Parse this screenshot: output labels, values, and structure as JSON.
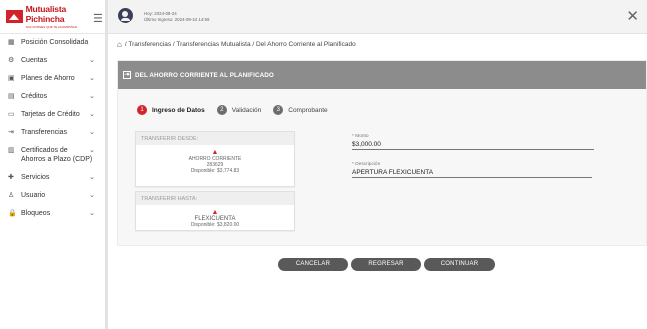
{
  "brand": {
    "name": "Mutualista Pichincha",
    "sub": "SOLUCIONES QUE TE ACOMPAÑAN"
  },
  "topbar": {
    "today": "Hoy: 2024-09-24",
    "last_login": "Último Ingreso: 2024-09-24 14:59"
  },
  "breadcrumb": {
    "path": "/ Transferencias / Transferencias Mutualista / Del Ahorro Corriente al Planificado"
  },
  "sidebar": {
    "items": [
      {
        "label": "Posición Consolidada",
        "icon": "grid-icon",
        "glyph": "▦",
        "chevron": false
      },
      {
        "label": "Cuentas",
        "icon": "settings-icon",
        "glyph": "⚙",
        "chevron": true
      },
      {
        "label": "Planes de Ahorro",
        "icon": "piggy-bank-icon",
        "glyph": "▣",
        "chevron": true
      },
      {
        "label": "Créditos",
        "icon": "credit-icon",
        "glyph": "▤",
        "chevron": true
      },
      {
        "label": "Tarjetas de Crédito",
        "icon": "card-icon",
        "glyph": "▭",
        "chevron": true
      },
      {
        "label": "Transferencias",
        "icon": "transfer-icon",
        "glyph": "⇥",
        "chevron": true
      },
      {
        "label": "Certificados de Ahorros a Plazo (CDP)",
        "icon": "certificate-icon",
        "glyph": "▥",
        "chevron": true
      },
      {
        "label": "Servicios",
        "icon": "services-icon",
        "glyph": "✚",
        "chevron": true
      },
      {
        "label": "Usuario",
        "icon": "user-icon",
        "glyph": "♙",
        "chevron": true
      },
      {
        "label": "Bloqueos",
        "icon": "lock-icon",
        "glyph": "🔒",
        "chevron": true
      }
    ]
  },
  "panel": {
    "title": "DEL AHORRO CORRIENTE AL PLANIFICADO"
  },
  "steps": [
    {
      "num": "1",
      "label": "Ingreso de Datos",
      "active": true
    },
    {
      "num": "2",
      "label": "Validación",
      "active": false
    },
    {
      "num": "3",
      "label": "Comprobante",
      "active": false
    }
  ],
  "from": {
    "title": "TRANSFERIR DESDE:",
    "account": "AHORRO CORRIENTE",
    "number": "283629",
    "available": "Disponible: $3,774.83"
  },
  "to": {
    "title": "TRANSFERIR HASTA:",
    "account": "FLEXICUENTA",
    "available": "Disponible: $3,820.00"
  },
  "form": {
    "amount_label": "* Monto",
    "amount_value": "$3,000.00",
    "description_label": "* Descripción",
    "description_value": "APERTURA FLEXICUENTA"
  },
  "buttons": {
    "cancel": "CANCELAR",
    "back": "REGRESAR",
    "continue": "CONTINUAR"
  },
  "colors": {
    "brand_red": "#d2232a",
    "header_gray": "#8c8c8c",
    "button_gray": "#595959"
  }
}
